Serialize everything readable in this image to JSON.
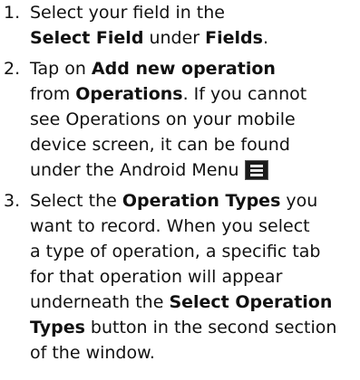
{
  "steps": [
    {
      "number": "1.",
      "line1": "Select your field in the",
      "line2_bold_a": "Select Field",
      "line2_text": " under ",
      "line2_bold_b": "Fields",
      "line2_end": "."
    },
    {
      "number": "2.",
      "line1_text": "Tap on ",
      "line1_bold": "Add new operation",
      "line2_text": "from ",
      "line2_bold": "Operations",
      "line2_end": ". If you cannot",
      "line3": "see Operations on your mobile",
      "line4": "device screen, it can be found",
      "line5": "under the Android Menu",
      "icon": "android-menu-icon"
    },
    {
      "number": "3.",
      "line1_text": "Select the ",
      "line1_bold": "Operation Types",
      "line1_end": " you",
      "line2": "want to record. When you select",
      "line3": "a type of operation, a specific tab",
      "line4": "for that operation will appear",
      "line5_text": "underneath the ",
      "line5_bold": "Select Operation",
      "line6_bold": "Types",
      "line6_end": " button in the second section",
      "line7": "of the window."
    }
  ]
}
